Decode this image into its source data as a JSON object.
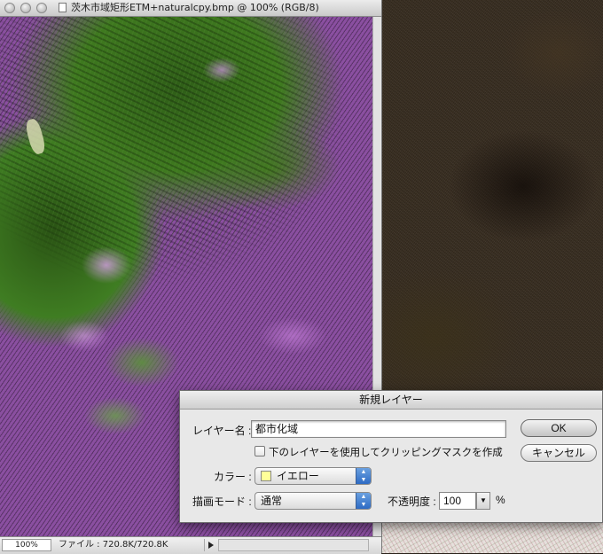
{
  "window": {
    "title": "茨木市域矩形ETM+naturalcpy.bmp @ 100% (RGB/8)"
  },
  "status": {
    "zoom": "100%",
    "file_info": "ファイル : 720.8K/720.8K"
  },
  "dialog": {
    "title": "新規レイヤー",
    "name_label": "レイヤー名 :",
    "name_value": "都市化域",
    "clip_label": "下のレイヤーを使用してクリッピングマスクを作成",
    "color_label": "カラー :",
    "color_value": "イエロー",
    "color_swatch": "#ffff99",
    "mode_label": "描画モード :",
    "mode_value": "通常",
    "opacity_label": "不透明度 :",
    "opacity_value": "100",
    "opacity_unit": "%",
    "ok_label": "OK",
    "cancel_label": "キャンセル"
  },
  "icons": {
    "close": "close-circle-icon",
    "minimize": "minimize-circle-icon",
    "zoom": "zoom-circle-icon",
    "document": "document-icon",
    "popup_arrows": "updown-arrows-icon",
    "stepper": "down-triangle-icon"
  }
}
